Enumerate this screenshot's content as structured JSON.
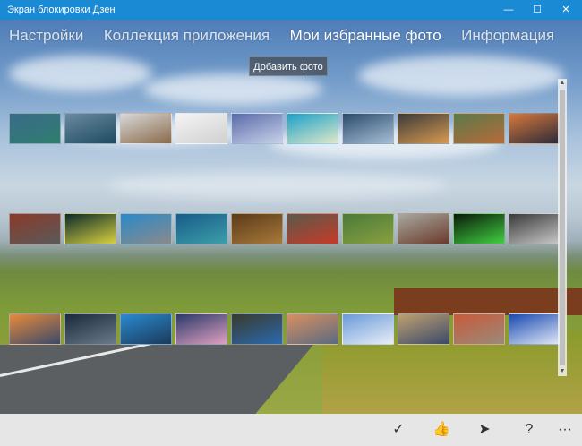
{
  "window": {
    "title": "Экран блокировки Дзен",
    "minimize_glyph": "—",
    "maximize_glyph": "☐",
    "close_glyph": "✕"
  },
  "tabs": [
    {
      "label": "Настройки",
      "active": false
    },
    {
      "label": "Коллекция приложения",
      "active": false
    },
    {
      "label": "Мои избранные фото",
      "active": true
    },
    {
      "label": "Информация",
      "active": false
    }
  ],
  "add_photo_label": "Добавить фото",
  "photo_rows": [
    [
      "lake-mountains",
      "frozen-river",
      "winter-deer",
      "white-rabbits",
      "ice-crystals",
      "tropical-lagoon",
      "birch-forest",
      "desert-rock",
      "squirrel",
      "sunset-cliff"
    ],
    [
      "red-flowers",
      "fireflies-night",
      "city-towers",
      "island-aerial",
      "stone-hall",
      "rooster",
      "cacti",
      "desert-camp",
      "green-glow",
      "snowy-rocks"
    ],
    [
      "coastal-cliffs",
      "dark-clouds",
      "mountain-lake",
      "mountain-sunset",
      "bus-sign",
      "canyon",
      "snow-peaks",
      "city-skyline",
      "red-rocks",
      "blue-mountains"
    ]
  ],
  "appbar": {
    "check_glyph": "✓",
    "like_glyph": "👍",
    "send_glyph": "➤",
    "help_glyph": "?",
    "more_glyph": "···"
  },
  "colors": {
    "titlebar": "#1a8ad4",
    "appbar": "#e6e6e6"
  }
}
